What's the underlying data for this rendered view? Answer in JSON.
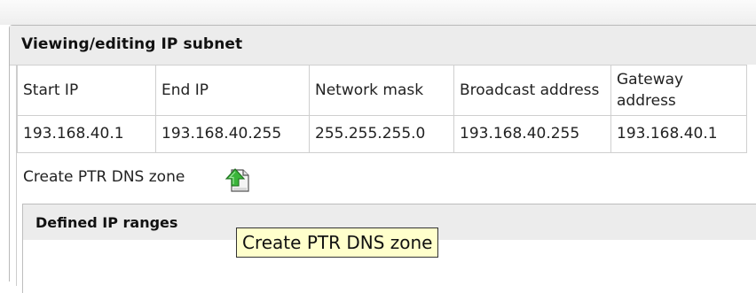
{
  "panel": {
    "title": "Viewing/editing IP subnet"
  },
  "subnet_table": {
    "headers": [
      "Start IP",
      "End IP",
      "Network mask",
      "Broadcast address",
      "Gateway address"
    ],
    "values": [
      "193.168.40.1",
      "193.168.40.255",
      "255.255.255.0",
      "193.168.40.255",
      "193.168.40.1"
    ]
  },
  "ptr": {
    "link_label": "Create PTR DNS zone",
    "icon": "export-up-arrow-icon"
  },
  "ranges": {
    "title": "Defined IP ranges"
  },
  "tooltip": {
    "text": "Create PTR DNS zone"
  },
  "colors": {
    "panel_header": "#ececec",
    "border": "#cfcfcf",
    "tooltip_bg": "#ffffcc",
    "icon_green": "#2fa52f"
  }
}
